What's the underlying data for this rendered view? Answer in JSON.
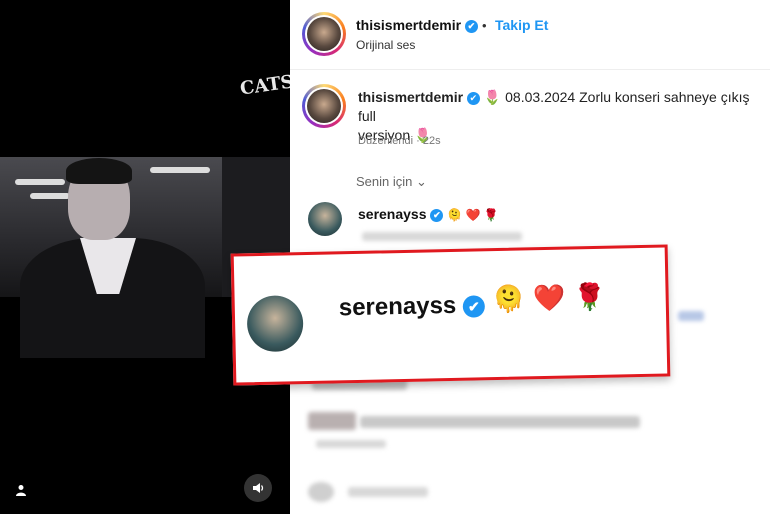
{
  "video": {
    "poster_text": "CATS",
    "user_icon": "user-icon",
    "volume_icon": "speaker-icon"
  },
  "header": {
    "username": "thisismertdemir",
    "verified_glyph": "✔",
    "separator": "•",
    "follow_label": "Takip Et",
    "audio_label": "Orijinal ses"
  },
  "post": {
    "username": "thisismertdemir",
    "verified_glyph": "✔",
    "caption_line1": "🌷 08.03.2024 Zorlu konseri sahneye çıkış full",
    "caption_line2": "versiyon 🌷",
    "edited": "Düzenlendi",
    "time": "22s"
  },
  "comments_filter": {
    "label": "Senin için",
    "chevron": "⌄"
  },
  "comment": {
    "username": "serenayss",
    "verified_glyph": "✔",
    "emojis": "🫠 ❤️ 🌹"
  },
  "zoom": {
    "username": "serenayss",
    "verified_glyph": "✔",
    "emojis": "🫠❤️🌹"
  }
}
